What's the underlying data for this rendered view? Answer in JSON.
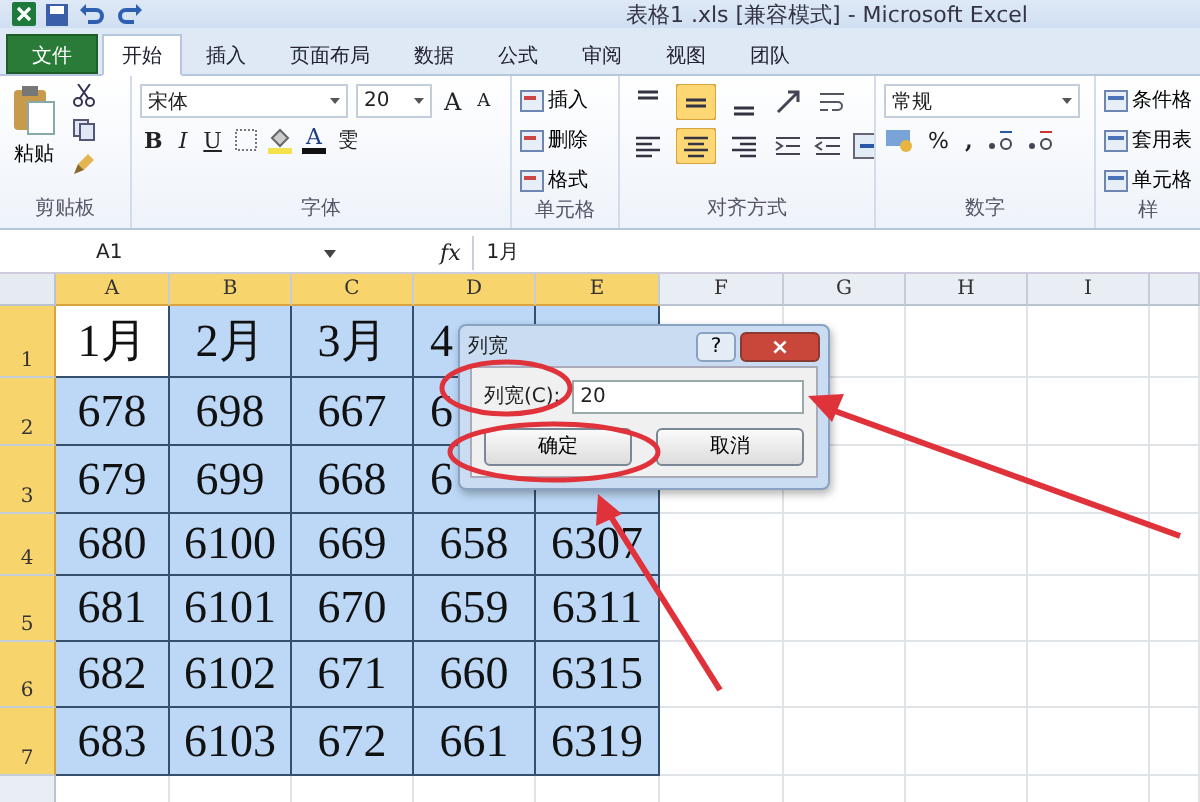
{
  "title_bar": {
    "title": "表格1 .xls  [兼容模式] - Microsoft Excel"
  },
  "ribbon_tabs": [
    {
      "label": "文件",
      "kind": "file",
      "selected": false
    },
    {
      "label": "开始",
      "kind": "tab",
      "selected": true
    },
    {
      "label": "插入",
      "kind": "tab",
      "selected": false
    },
    {
      "label": "页面布局",
      "kind": "tab",
      "selected": false
    },
    {
      "label": "数据",
      "kind": "tab",
      "selected": false
    },
    {
      "label": "公式",
      "kind": "tab",
      "selected": false
    },
    {
      "label": "审阅",
      "kind": "tab",
      "selected": false
    },
    {
      "label": "视图",
      "kind": "tab",
      "selected": false
    },
    {
      "label": "团队",
      "kind": "tab",
      "selected": false
    }
  ],
  "clipboard": {
    "paste": "粘贴",
    "group": "剪贴板"
  },
  "font": {
    "name": "宋体",
    "size": "20",
    "bold": "B",
    "italic": "I",
    "underline": "U",
    "grow": "A",
    "shrink": "A",
    "color_letter": "A",
    "phonetic": "雯",
    "group": "字体"
  },
  "cells": {
    "items": [
      "插入",
      "删除",
      "格式"
    ],
    "group": "单元格"
  },
  "alignment": {
    "vertical": [
      {
        "selected": false
      },
      {
        "selected": true
      },
      {
        "selected": false
      }
    ],
    "horizontal": [
      {
        "selected": false
      },
      {
        "selected": true
      },
      {
        "selected": false
      }
    ],
    "group": "对齐方式"
  },
  "number": {
    "format": "常规",
    "percent": "%",
    "comma": ",",
    "group": "数字"
  },
  "styles": {
    "items": [
      "条件格",
      "套用表",
      "单元格"
    ],
    "group": "样"
  },
  "formula_bar": {
    "name_box": "A1",
    "fx": "fx",
    "value": "1月"
  },
  "sheet": {
    "columns": [
      {
        "label": "A",
        "selected": true
      },
      {
        "label": "B",
        "selected": true
      },
      {
        "label": "C",
        "selected": true
      },
      {
        "label": "D",
        "selected": true
      },
      {
        "label": "E",
        "selected": true
      },
      {
        "label": "F",
        "selected": false
      },
      {
        "label": "G",
        "selected": false
      },
      {
        "label": "H",
        "selected": false
      },
      {
        "label": "I",
        "selected": false
      }
    ],
    "rows": [
      {
        "number": "1",
        "selected": true,
        "cells": [
          {
            "value": "1月",
            "active": true
          },
          {
            "value": "2月"
          },
          {
            "value": "3月"
          },
          {
            "value": "4",
            "covered": true
          }
        ]
      },
      {
        "number": "2",
        "selected": true,
        "cells": [
          {
            "value": "678"
          },
          {
            "value": "698"
          },
          {
            "value": "667"
          },
          {
            "value": "6",
            "covered": true
          }
        ]
      },
      {
        "number": "3",
        "selected": true,
        "cells": [
          {
            "value": "679"
          },
          {
            "value": "699"
          },
          {
            "value": "668"
          },
          {
            "value": "6",
            "covered": true
          }
        ]
      },
      {
        "number": "4",
        "selected": true,
        "cells": [
          {
            "value": "680"
          },
          {
            "value": "6100"
          },
          {
            "value": "669"
          },
          {
            "value": "658"
          },
          {
            "value": "6307"
          }
        ]
      },
      {
        "number": "5",
        "selected": true,
        "cells": [
          {
            "value": "681"
          },
          {
            "value": "6101"
          },
          {
            "value": "670"
          },
          {
            "value": "659"
          },
          {
            "value": "6311"
          }
        ]
      },
      {
        "number": "6",
        "selected": true,
        "cells": [
          {
            "value": "682"
          },
          {
            "value": "6102"
          },
          {
            "value": "671"
          },
          {
            "value": "660"
          },
          {
            "value": "6315"
          }
        ]
      },
      {
        "number": "7",
        "selected": true,
        "cells": [
          {
            "value": "683"
          },
          {
            "value": "6103"
          },
          {
            "value": "672"
          },
          {
            "value": "661"
          },
          {
            "value": "6319"
          }
        ]
      }
    ]
  },
  "dialog": {
    "title": "列宽",
    "help": "?",
    "close": "×",
    "label": "列宽(C):",
    "value": "20",
    "ok": "确定",
    "cancel": "取消"
  }
}
